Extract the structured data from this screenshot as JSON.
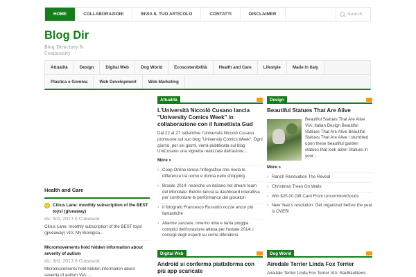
{
  "topnav": {
    "items": [
      "HOME",
      "COLLABORAZIONI",
      "INVIA IL TUO ARTICOLO",
      "CONTATTI",
      "DISCLAIMER"
    ],
    "search_placeholder": "Search"
  },
  "site": {
    "title": "Blog Dir",
    "description": "Blog Directory & Community"
  },
  "catnav": {
    "row1": [
      "Attualità",
      "Design",
      "Digital Web",
      "Dog World",
      "Ecosostenibilità",
      "Health and Care",
      "Lifestyle",
      "Made in Italy"
    ],
    "row2": [
      "Plastica e Gomma",
      "Web Development",
      "Web Marketing"
    ]
  },
  "sidebar": {
    "heading": "Health and Care",
    "posts": [
      {
        "title": "Citrus Lane: monthly subscription of the BEST toys! (giveaway)",
        "meta": "dic 3rd, 2013  0 Comment",
        "excerpt": "Citrus Lane: monthly subscription of the BEST toys! (giveaway) VIA: My Biologica..."
      },
      {
        "title": "Micromovements hold hidden information about severity of autism",
        "meta": "dic 3rd, 2013  0 Comment",
        "excerpt": "Micromovements hold hidden information about severity of autism VIA: ..."
      }
    ]
  },
  "col_attualita": {
    "label": "Attualità",
    "title": "L'Università Niccolò Cusano lancia \"University Comics Week\" in collaborazione con il fumettista Gud",
    "excerpt": "Dal 22 al 27 settembre l'Università Niccolò Cusano promuove sul suo blog \"University Comics Week\". Ogni giorno, per sei giorni, verrà pubblicata sul blog UniCusano una vignetta realizzata dall'autore...",
    "more": "More »",
    "list": [
      "Coop Online lancia l'infografica che rivela le differenze tra uomo e donna nello shopping",
      "Brasile 2014: neanche un italiano nel dream team del Mondiale. Betclic lancia la dashboard interattiva per confrontare le performance dei giocatori",
      "Il fotografo Francesco Russotto nozze ancor più fantastiche",
      "Allarme zanzare, inverno mite e tanta pioggia complici dell'invasione attesa per l'estate 2014: i consigli degli esperti su come difendersi"
    ]
  },
  "col_design": {
    "label": "Design",
    "title": "Beautiful Statues That Are Alive",
    "excerpt": "Beautiful Statues That Are Alive VIA: Italian Design Beautiful Statues That Are Alive Beautiful Statues That Are Alive I stumbled upon these beautiful garden statues that look alive! Statues in your...",
    "more": "More »",
    "list": [
      "Ranch Renovation The Reveal",
      "Christmas Trees On Walls",
      "Win $25.00 Gift Card From UncommonGoods",
      "New Year's resolution: Get organized before the year is OVER!"
    ]
  },
  "col_digitalweb": {
    "label": "Digital Web",
    "title": "Android si conferma piattaforma con più app scaricate"
  },
  "col_dogworld": {
    "label": "Dog World",
    "title": "Airedale Terrier Linda Fox Terrier",
    "excerpt": "Airedale Terrier Linda Fox Terrier VIA: BauBauNews"
  }
}
